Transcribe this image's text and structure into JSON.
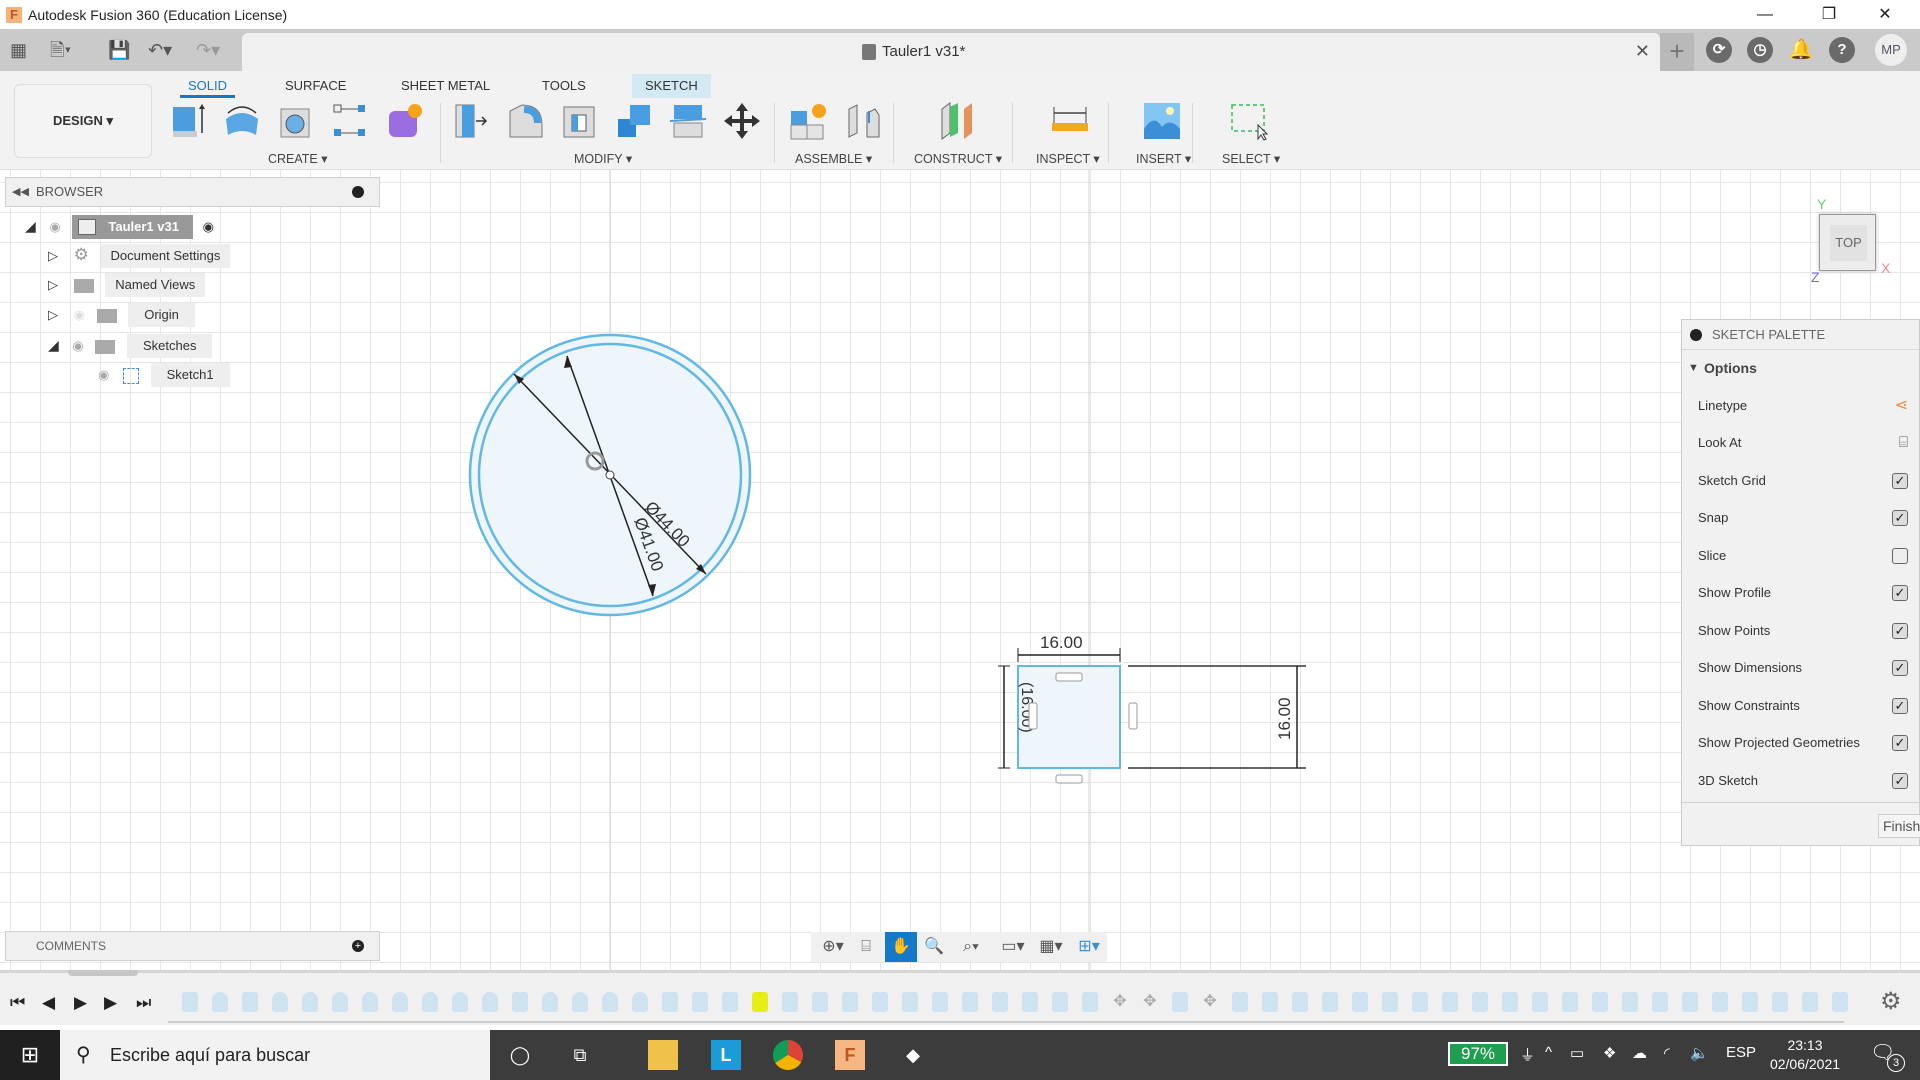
{
  "window": {
    "app_title": "Autodesk Fusion 360 (Education License)",
    "app_icon": "F",
    "controls": {
      "minimize": "—",
      "restore": "❐",
      "close": "✕"
    }
  },
  "quick_access": {
    "icons": [
      "grid-menu-icon",
      "file-icon",
      "save-icon",
      "undo-icon",
      "redo-icon"
    ]
  },
  "document_tab": {
    "name": "Tauler1 v31*",
    "close": "✕",
    "new_tab": "+"
  },
  "top_right": {
    "avatar": "MP",
    "icons": [
      "extensions-icon",
      "job-status-icon",
      "notifications-icon",
      "help-icon"
    ]
  },
  "ribbon": {
    "workspace": "DESIGN ▾",
    "tabs": [
      {
        "label": "SOLID",
        "active": true
      },
      {
        "label": "SURFACE"
      },
      {
        "label": "SHEET METAL"
      },
      {
        "label": "TOOLS"
      },
      {
        "label": "SKETCH",
        "contextual": true
      }
    ],
    "groups": [
      {
        "label": "CREATE ▾",
        "tools": [
          "extrude",
          "revolve",
          "hole",
          "pattern",
          "create-form"
        ]
      },
      {
        "label": "MODIFY ▾",
        "tools": [
          "press-pull",
          "fillet",
          "shell",
          "combine",
          "split-body",
          "move"
        ]
      },
      {
        "label": "ASSEMBLE ▾",
        "tools": [
          "new-component",
          "joint"
        ]
      },
      {
        "label": "CONSTRUCT ▾",
        "tools": [
          "offset-plane"
        ]
      },
      {
        "label": "INSPECT ▾",
        "tools": [
          "measure"
        ]
      },
      {
        "label": "INSERT ▾",
        "tools": [
          "insert-image"
        ]
      },
      {
        "label": "SELECT ▾",
        "tools": [
          "window-select"
        ]
      }
    ]
  },
  "browser": {
    "title": "BROWSER",
    "items": [
      {
        "label": "Tauler1 v31",
        "level": 0,
        "expanded": true
      },
      {
        "label": "Document Settings",
        "level": 1,
        "expanded": false
      },
      {
        "label": "Named Views",
        "level": 1,
        "expanded": false
      },
      {
        "label": "Origin",
        "level": 1,
        "expanded": false,
        "hidden": true
      },
      {
        "label": "Sketches",
        "level": 1,
        "expanded": true
      },
      {
        "label": "Sketch1",
        "level": 2
      }
    ]
  },
  "viewcube": {
    "face": "TOP",
    "axes": {
      "x": "X",
      "y": "Y",
      "z": "Z"
    }
  },
  "sketch": {
    "circle_dims": [
      "Ø44.00",
      "Ø41.00"
    ],
    "rect_dims": {
      "width": "16.00",
      "height": "16.00",
      "driven": "(16.00)"
    }
  },
  "sketch_palette": {
    "title": "SKETCH PALETTE",
    "section": "Options",
    "rows": [
      {
        "label": "Linetype",
        "type": "icon"
      },
      {
        "label": "Look At",
        "type": "icon"
      },
      {
        "label": "Sketch Grid",
        "checked": true
      },
      {
        "label": "Snap",
        "checked": true
      },
      {
        "label": "Slice",
        "checked": false
      },
      {
        "label": "Show Profile",
        "checked": true
      },
      {
        "label": "Show Points",
        "checked": true
      },
      {
        "label": "Show Dimensions",
        "checked": true
      },
      {
        "label": "Show Constraints",
        "checked": true
      },
      {
        "label": "Show Projected Geometries",
        "checked": true
      },
      {
        "label": "3D Sketch",
        "checked": true
      }
    ],
    "finish": "Finish"
  },
  "comments": {
    "title": "COMMENTS"
  },
  "nav_bar": {
    "tools": [
      "orbit",
      "look-at",
      "pan",
      "zoom",
      "fit",
      "display-settings",
      "grid-snaps",
      "viewports"
    ],
    "active": "pan"
  },
  "timeline": {
    "controls": [
      "⏮",
      "◀",
      "▶",
      "▶",
      "⏭"
    ],
    "items": [
      "ext",
      "rev",
      "ext",
      "rev",
      "rev",
      "rev",
      "rev",
      "rev",
      "rev",
      "rev",
      "rev",
      "ext",
      "rev",
      "rev",
      "rev",
      "rev",
      "ext",
      "ext",
      "ext",
      "ext-current",
      "ext",
      "ext",
      "ext",
      "ext",
      "ext",
      "ext",
      "ext",
      "ext",
      "ext",
      "ext",
      "sketch",
      "move",
      "move",
      "ext",
      "move",
      "ext",
      "ext",
      "ext",
      "ext",
      "ext",
      "ext",
      "ext",
      "ext",
      "ext",
      "ext",
      "ext",
      "ext",
      "ext",
      "ext",
      "ext",
      "ext",
      "ext",
      "ext",
      "ext",
      "ext",
      "ext"
    ]
  },
  "taskbar": {
    "search_placeholder": "Escribe aquí para buscar",
    "battery": "97%",
    "language": "ESP",
    "time": "23:13",
    "date": "02/06/2021",
    "notifications": "3"
  }
}
